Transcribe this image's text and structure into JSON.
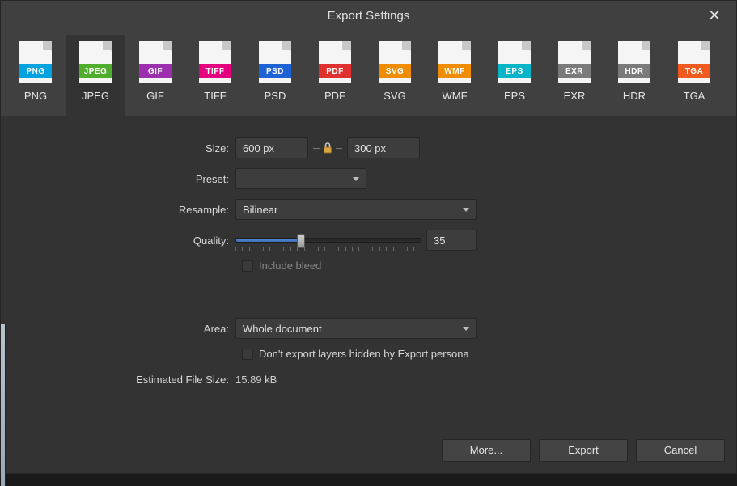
{
  "title": "Export Settings",
  "formats": [
    {
      "label": "PNG",
      "band": "PNG",
      "color": "#00A3E0"
    },
    {
      "label": "JPEG",
      "band": "JPEG",
      "color": "#4FAF2D"
    },
    {
      "label": "GIF",
      "band": "GIF",
      "color": "#9B2FAE"
    },
    {
      "label": "TIFF",
      "band": "TIFF",
      "color": "#E4007F"
    },
    {
      "label": "PSD",
      "band": "PSD",
      "color": "#1E63D6"
    },
    {
      "label": "PDF",
      "band": "PDF",
      "color": "#E03030"
    },
    {
      "label": "SVG",
      "band": "SVG",
      "color": "#F08C00"
    },
    {
      "label": "WMF",
      "band": "WMF",
      "color": "#F08C00"
    },
    {
      "label": "EPS",
      "band": "EPS",
      "color": "#07B5C8"
    },
    {
      "label": "EXR",
      "band": "EXR",
      "color": "#7A7A7A"
    },
    {
      "label": "HDR",
      "band": "HDR",
      "color": "#7A7A7A"
    },
    {
      "label": "TGA",
      "band": "TGA",
      "color": "#F05A1E"
    }
  ],
  "selected_format_index": 1,
  "labels": {
    "size": "Size:",
    "preset": "Preset:",
    "resample": "Resample:",
    "quality": "Quality:",
    "include_bleed": "Include bleed",
    "area": "Area:",
    "dont_export_hidden": "Don't export layers hidden by Export persona",
    "estimated": "Estimated File Size:"
  },
  "size": {
    "width": "600 px",
    "height": "300 px"
  },
  "preset": "",
  "resample": "Bilinear",
  "quality": {
    "value": "35",
    "percent": 35
  },
  "include_bleed_checked": false,
  "area": "Whole document",
  "dont_export_hidden_checked": false,
  "estimated_size": "15.89 kB",
  "buttons": {
    "more": "More...",
    "export": "Export",
    "cancel": "Cancel"
  }
}
